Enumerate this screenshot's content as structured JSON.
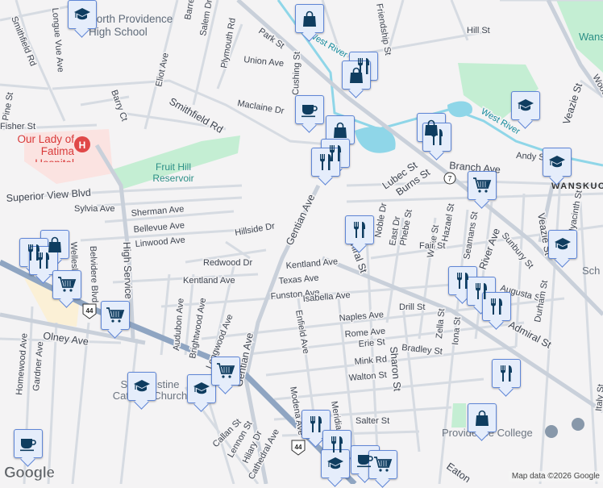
{
  "streets": [
    "Smithfield Rd",
    "Longue Vue Ave",
    "Barrett",
    "Salem Dr",
    "Plymouth Rd",
    "Park St",
    "Union Ave",
    "Cushing St",
    "Eliot Ave",
    "Maclaine Dr",
    "Smithfield Rd",
    "Barry Ct",
    "Pine St",
    "Fisher St",
    "Superior View Blvd",
    "Sylvia Ave",
    "Sherman Ave",
    "Bellevue Ave",
    "Linwood Ave",
    "Hillside Dr",
    "Gentian Ave",
    "Redwood Dr",
    "Kentland Ave",
    "Kentland Ave",
    "Texas Ave",
    "Funston Ave",
    "Isabella Ave",
    "Naples Ave",
    "Rome Ave",
    "Erie St",
    "Mink Rd",
    "Walton St",
    "Bradley St",
    "Drill St",
    "Sharon St",
    "Salter St",
    "Enfield Ave",
    "Modena Ave",
    "Meridian",
    "Admiral St",
    "Audubon Ave",
    "Brightwood Ave",
    "Longwood Ave",
    "Gentian Ave",
    "Callan St",
    "Lennon St",
    "Hilary Dr",
    "Cathedral Ave",
    "Olney Ave",
    "Homewood Ave",
    "Gardner Ave",
    "Belvidere Blvd",
    "High Service",
    "Wellesley",
    "Friendship St",
    "Hill St",
    "Lubec St",
    "Burns St",
    "Branch Ave",
    "Andy St",
    "Veazie St",
    "Veazie St",
    "Hyacinth St",
    "Sunbury St",
    "Augusta St",
    "Durham St",
    "Zella St",
    "Iona St",
    "Phebe St",
    "Waite St",
    "Hazael St",
    "Seamans St",
    "East Dr",
    "Noble Dr",
    "Fair St",
    "River Ave",
    "Italy St",
    "Eaton",
    "Admiral St",
    "Woodward"
  ],
  "water_labels": [
    "West River",
    "West River"
  ],
  "places": {
    "school": "North Providence High School",
    "hospital": "Our Lady of Fatima Hospital",
    "reservoir": "Fruit Hill Reservoir",
    "church": "St Augustine Catholic Church",
    "college": "Providence College",
    "neighborhood": "WANSKUCK",
    "park": "Wanskuck Park",
    "school2": "Sch"
  },
  "route_shields": {
    "us44_a": "44",
    "us44_b": "44",
    "ri7": "7"
  },
  "markers": [
    "school",
    "shopping",
    "restaurant",
    "shopping",
    "coffee",
    "shopping",
    "restaurant",
    "restaurant",
    "shopping",
    "restaurant",
    "school",
    "school",
    "grocery",
    "school",
    "restaurant",
    "shopping",
    "restaurant",
    "restaurant",
    "grocery",
    "grocery",
    "restaurant",
    "restaurant",
    "restaurant",
    "school",
    "school",
    "grocery",
    "restaurant",
    "shopping",
    "coffee",
    "restaurant",
    "restaurant",
    "school",
    "coffee",
    "grocery"
  ],
  "footer": {
    "logo": "Google",
    "attribution": "Map data ©2026 Google"
  }
}
